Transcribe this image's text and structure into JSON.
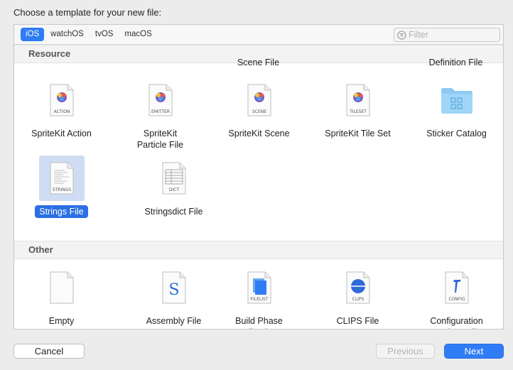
{
  "prompt": "Choose a template for your new file:",
  "tabs": [
    {
      "label": "iOS",
      "active": true
    },
    {
      "label": "watchOS",
      "active": false
    },
    {
      "label": "tvOS",
      "active": false
    },
    {
      "label": "macOS",
      "active": false
    }
  ],
  "filter": {
    "placeholder": "Filter",
    "value": ""
  },
  "clipped_labels": {
    "left": "Scene File",
    "right": "Definition File"
  },
  "sections": {
    "resource": {
      "title": "Resource",
      "items": [
        {
          "label": "SpriteKit Action",
          "tag": "ACTION",
          "icon": "spritekit-action-icon"
        },
        {
          "label": "SpriteKit Particle File",
          "tag": "EMITTER",
          "icon": "spritekit-particle-icon"
        },
        {
          "label": "SpriteKit Scene",
          "tag": "SCENE",
          "icon": "spritekit-scene-icon"
        },
        {
          "label": "SpriteKit Tile Set",
          "tag": "TILESET",
          "icon": "spritekit-tileset-icon"
        },
        {
          "label": "Sticker Catalog",
          "tag": "",
          "icon": "sticker-catalog-folder-icon"
        },
        {
          "label": "Strings File",
          "tag": "STRINGS",
          "icon": "strings-file-icon",
          "selected": true
        },
        {
          "label": "Stringsdict File",
          "tag": "DICT",
          "icon": "stringsdict-file-icon"
        }
      ]
    },
    "other": {
      "title": "Other",
      "items": [
        {
          "label": "Empty",
          "tag": "",
          "icon": "empty-file-icon"
        },
        {
          "label": "Assembly File",
          "tag": "S",
          "icon": "assembly-file-icon"
        },
        {
          "label": "Build Phase File List",
          "tag": "FILELIST",
          "icon": "filelist-icon"
        },
        {
          "label": "CLIPS File",
          "tag": "CLIPS",
          "icon": "clips-file-icon"
        },
        {
          "label": "Configuration Settings File",
          "tag": "CONFIG",
          "icon": "config-file-icon"
        }
      ]
    }
  },
  "buttons": {
    "cancel": "Cancel",
    "previous": "Previous",
    "next": "Next"
  },
  "colors": {
    "accent": "#2f7cf6",
    "selection_bg": "#cfdcf3",
    "spritekit_purple": "#7a5cc8"
  }
}
